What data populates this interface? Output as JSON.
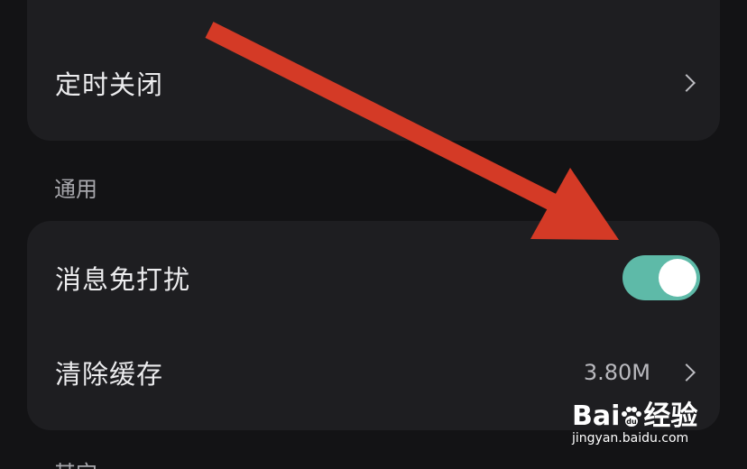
{
  "settings": {
    "timer_off_label": "定时关闭",
    "general_section_title": "通用",
    "dnd_label": "消息免打扰",
    "dnd_enabled": true,
    "clear_cache_label": "清除缓存",
    "cache_size": "3.80M",
    "next_section_title": "其它"
  },
  "watermark": {
    "brand": "Bai du 经验",
    "brand_left": "Bai",
    "brand_right": "经验",
    "url": "jingyan.baidu.com"
  },
  "colors": {
    "background": "#131315",
    "card": "#1e1e21",
    "toggle_on": "#5ebaa8",
    "annotation_arrow": "#d43a26"
  },
  "icons": {
    "chevron": "chevron-right-icon",
    "annotation": "red-arrow-annotation"
  }
}
